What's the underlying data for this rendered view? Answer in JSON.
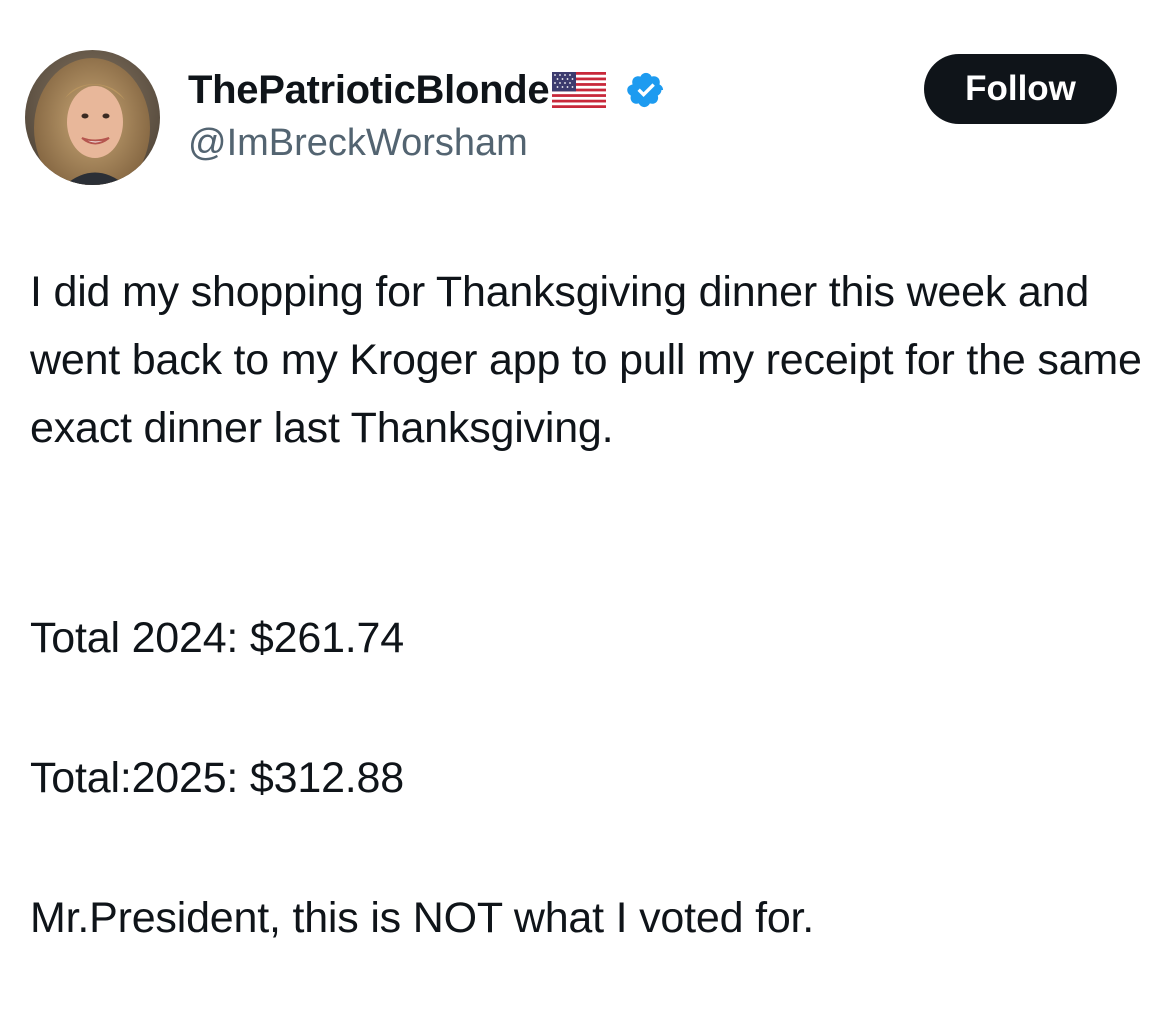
{
  "header": {
    "display_name": "ThePatrioticBlonde",
    "handle": "@ImBreckWorsham",
    "follow_label": "Follow",
    "icons": {
      "avatar": "profile-photo",
      "flag": "us-flag-emoji",
      "badge": "verified-badge"
    }
  },
  "tweet": {
    "paragraphs": [
      "I did my shopping for Thanksgiving dinner this week and went back to my Kroger app to pull my receipt for the same exact dinner last Thanksgiving.",
      "Total 2024: $261.74",
      "Total:2025: $312.88",
      "Mr.President, this is NOT what I voted for."
    ]
  },
  "colors": {
    "text": "#0f1419",
    "secondary": "#536471",
    "button_bg": "#0f1419",
    "button_text": "#ffffff",
    "verified": "#1d9bf0"
  }
}
